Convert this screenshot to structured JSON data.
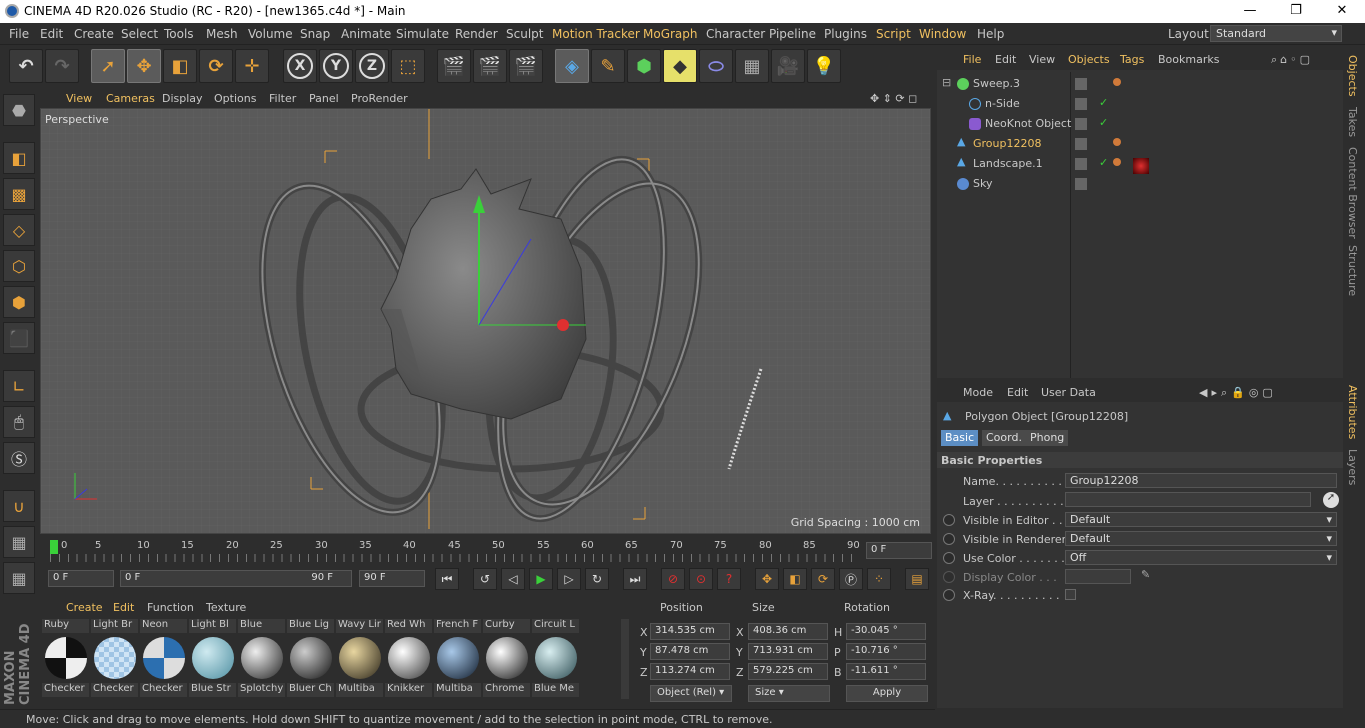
{
  "window": {
    "title": "CINEMA 4D R20.026 Studio (RC - R20) - [new1365.c4d *] - Main",
    "minimize": "—",
    "maximize": "❐",
    "close": "✕"
  },
  "menubar": {
    "items": [
      "File",
      "Edit",
      "Create",
      "Select",
      "Tools",
      "Mesh",
      "Volume",
      "Snap",
      "Animate",
      "Simulate",
      "Render",
      "Sculpt",
      "Motion Tracker",
      "MoGraph",
      "Character",
      "Pipeline",
      "Plugins",
      "Script",
      "Window",
      "Help"
    ],
    "layout_label": "Layout:",
    "layout_value": "Standard"
  },
  "toolbar": {
    "axis_x": "X",
    "axis_y": "Y",
    "axis_z": "Z"
  },
  "viewport": {
    "menu": [
      "View",
      "Cameras",
      "Display",
      "Options",
      "Filter",
      "Panel",
      "ProRender"
    ],
    "label": "Perspective",
    "grid_spacing": "Grid Spacing : 1000 cm"
  },
  "timeline": {
    "ticks": [
      "0",
      "5",
      "10",
      "15",
      "20",
      "25",
      "30",
      "35",
      "40",
      "45",
      "50",
      "55",
      "60",
      "65",
      "70",
      "75",
      "80",
      "85",
      "90"
    ],
    "current_frame": "0 F"
  },
  "timecontrols": {
    "start_field": "0 F",
    "min_field": "0 F",
    "max_field_inner": "90 F",
    "end_field": "90 F"
  },
  "materials": {
    "menu": [
      "Create",
      "Edit",
      "Function",
      "Texture"
    ],
    "items": [
      {
        "name": "Ruby",
        "tex": "Checker"
      },
      {
        "name": "Light Br",
        "tex": "Checker"
      },
      {
        "name": "Neon",
        "tex": "Checker"
      },
      {
        "name": "Light Bl",
        "tex": "Blue Str"
      },
      {
        "name": "Blue",
        "tex": "Splotchy"
      },
      {
        "name": "Blue Lig",
        "tex": "Bluer Ch"
      },
      {
        "name": "Wavy Lir",
        "tex": "Multiba"
      },
      {
        "name": "Red Wh",
        "tex": "Knikker"
      },
      {
        "name": "French F",
        "tex": "Multiba"
      },
      {
        "name": "Curby",
        "tex": "Chrome"
      },
      {
        "name": "Circuit L",
        "tex": "Blue Me"
      }
    ]
  },
  "coordinates": {
    "headers": [
      "Position",
      "Size",
      "Rotation"
    ],
    "rows": [
      {
        "pl": "X",
        "pv": "314.535 cm",
        "sl": "X",
        "sv": "408.36 cm",
        "rl": "H",
        "rv": "-30.045 °"
      },
      {
        "pl": "Y",
        "pv": "87.478 cm",
        "sl": "Y",
        "sv": "713.931 cm",
        "rl": "P",
        "rv": "-10.716 °"
      },
      {
        "pl": "Z",
        "pv": "113.274 cm",
        "sl": "Z",
        "sv": "579.225 cm",
        "rl": "B",
        "rv": "-11.611 °"
      }
    ],
    "mode": "Object (Rel)",
    "size_mode": "Size",
    "apply": "Apply"
  },
  "status": "Move: Click and drag to move elements. Hold down SHIFT to quantize movement / add to the selection in point mode, CTRL to remove.",
  "objects_panel": {
    "menu": [
      "File",
      "Edit",
      "View",
      "Objects",
      "Tags",
      "Bookmarks"
    ],
    "items": [
      {
        "name": "Sweep.3",
        "indent": 0
      },
      {
        "name": "n-Side",
        "indent": 1
      },
      {
        "name": "NeoKnot Object",
        "indent": 1
      },
      {
        "name": "Group12208",
        "indent": 0
      },
      {
        "name": "Landscape.1",
        "indent": 0
      },
      {
        "name": "Sky",
        "indent": 0
      }
    ]
  },
  "attributes": {
    "menu": [
      "Mode",
      "Edit",
      "User Data"
    ],
    "object_title": "Polygon Object [Group12208]",
    "tabs": [
      "Basic",
      "Coord.",
      "Phong"
    ],
    "section": "Basic Properties",
    "fields": [
      {
        "label": "Name. . . . . . . . . . .",
        "value": "Group12208"
      },
      {
        "label": "Layer . . . . . . . . . .",
        "value": ""
      },
      {
        "label": "Visible in Editor . .",
        "value": "Default"
      },
      {
        "label": "Visible in Renderer",
        "value": "Default"
      },
      {
        "label": "Use Color . . . . . . .",
        "value": "Off"
      },
      {
        "label": "Display Color . . .",
        "value": ""
      },
      {
        "label": "X-Ray. . . . . . . . . .",
        "value": ""
      }
    ]
  },
  "right_tabs": [
    "Objects",
    "Takes",
    "Content Browser",
    "Structure",
    "Attributes",
    "Layers"
  ],
  "maxon": "MAXON CINEMA 4D",
  "colors": {
    "accent": "#f0c060",
    "selection": "#5c8ec4",
    "bg": "#2d2d2d"
  }
}
